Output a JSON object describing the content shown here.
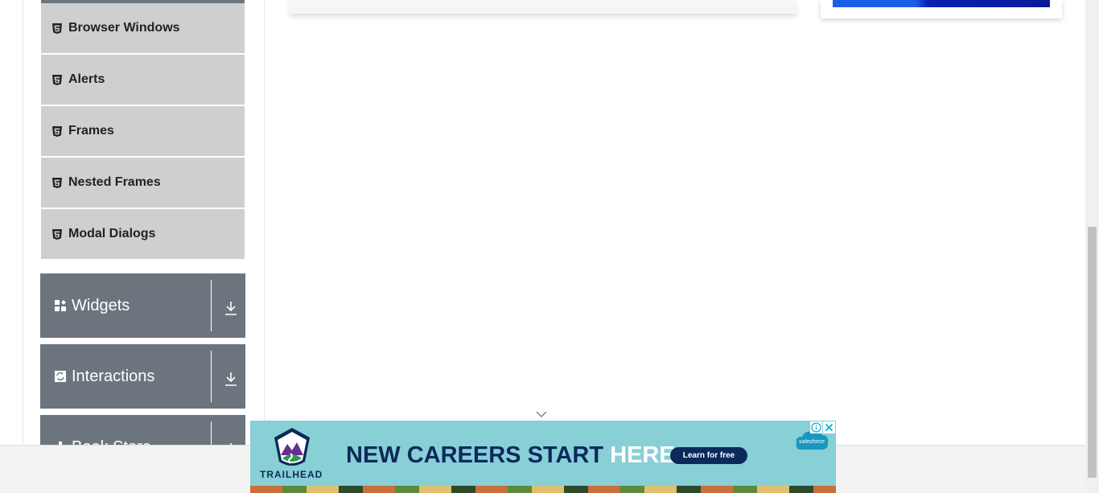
{
  "sidebar": {
    "items": [
      {
        "label": "Browser Windows",
        "icon": "html5-icon"
      },
      {
        "label": "Alerts",
        "icon": "html5-icon"
      },
      {
        "label": "Frames",
        "icon": "html5-icon"
      },
      {
        "label": "Nested Frames",
        "icon": "html5-icon"
      },
      {
        "label": "Modal Dialogs",
        "icon": "html5-icon"
      }
    ],
    "groups": [
      {
        "label": "Widgets",
        "icon": "widgets-icon"
      },
      {
        "label": "Interactions",
        "icon": "interactions-icon"
      },
      {
        "label": "Book Store",
        "icon": "book-store-icon"
      }
    ]
  },
  "ad": {
    "brand": "TRAILHEAD",
    "headline_main": "NEW CAREERS START ",
    "headline_highlight": "HERE.",
    "cta": "Learn for free",
    "sponsor": "salesforce"
  },
  "colors": {
    "menu_item_bg": "#cfcfcf",
    "group_bg": "#6c757d",
    "ad_bg": "#88cfd6",
    "ad_text": "#0b2a5b"
  }
}
